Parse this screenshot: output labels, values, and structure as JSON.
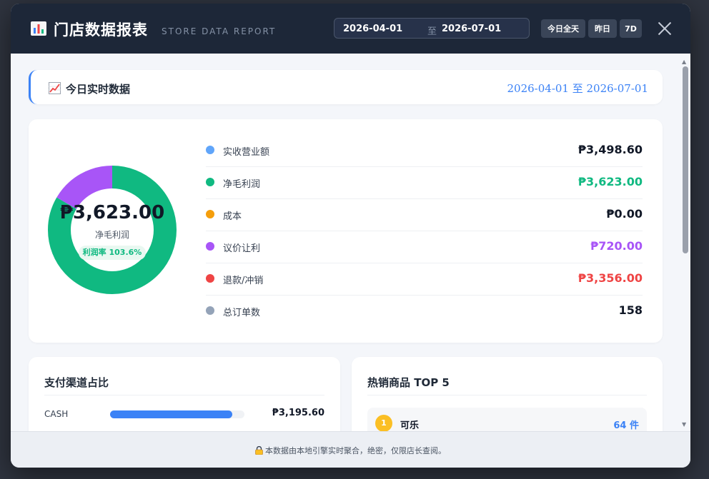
{
  "header": {
    "icon": "bar-chart-icon",
    "title": "门店数据报表",
    "subtitle": "STORE DATA REPORT",
    "date_start": "2026-04-01",
    "date_sep": "至",
    "date_end": "2026-07-01",
    "quick_buttons": [
      "今日全天",
      "昨日",
      "7D"
    ],
    "close_icon": "close-icon"
  },
  "banner": {
    "icon": "chart-increasing-icon",
    "title": "今日实时数据",
    "date_range": "2026-04-01 至 2026-07-01"
  },
  "summary": {
    "donut_value": "₱3,623.00",
    "donut_label": "净毛利润",
    "profit_rate": "利润率 103.6%",
    "donut_segments": [
      {
        "name": "净毛利润",
        "fraction": 0.834,
        "color": "#10b981"
      },
      {
        "name": "议价让利",
        "fraction": 0.166,
        "color": "#a855f7"
      }
    ],
    "stats": [
      {
        "label": "实收营业额",
        "value": "₱3,498.60",
        "dot_color": "#60a5fa",
        "value_color": "#111827"
      },
      {
        "label": "净毛利润",
        "value": "₱3,623.00",
        "dot_color": "#10b981",
        "value_color": "#10b981"
      },
      {
        "label": "成本",
        "value": "₱0.00",
        "dot_color": "#f59e0b",
        "value_color": "#111827"
      },
      {
        "label": "议价让利",
        "value": "₱720.00",
        "dot_color": "#a855f7",
        "value_color": "#a855f7"
      },
      {
        "label": "退款/冲销",
        "value": "₱3,356.00",
        "dot_color": "#ef4444",
        "value_color": "#ef4444"
      },
      {
        "label": "总订单数",
        "value": "158",
        "dot_color": "#94a3b8",
        "value_color": "#111827"
      }
    ]
  },
  "payment": {
    "title": "支付渠道占比",
    "channels": [
      {
        "name": "CASH",
        "share": 0.91,
        "amount": "₱3,195.60",
        "color": "#3b82f6"
      }
    ]
  },
  "hot_products": {
    "title": "热销商品 TOP 5",
    "items": [
      {
        "rank": "1",
        "name": "可乐",
        "qty": "64 件"
      }
    ]
  },
  "footer": {
    "icon": "lock-icon",
    "text": "本数据由本地引擎实时聚合，绝密，仅限店长查阅。"
  }
}
